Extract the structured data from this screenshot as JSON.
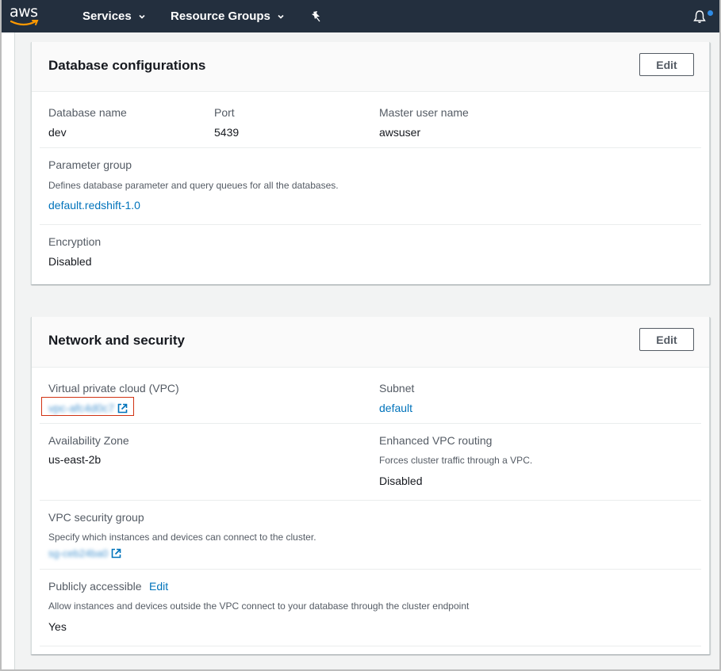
{
  "navbar": {
    "logo": "aws",
    "services_label": "Services",
    "resource_groups_label": "Resource Groups",
    "icons": [
      "aws-logo",
      "chevron-down-icon",
      "pin-icon",
      "bell-icon",
      "notification-dot"
    ]
  },
  "database_configurations": {
    "title": "Database configurations",
    "edit_label": "Edit",
    "database_name_label": "Database name",
    "database_name_value": "dev",
    "port_label": "Port",
    "port_value": "5439",
    "master_user_label": "Master user name",
    "master_user_value": "awsuser",
    "parameter_group_label": "Parameter group",
    "parameter_group_desc": "Defines database parameter and query queues for all the databases.",
    "parameter_group_value": "default.redshift-1.0",
    "encryption_label": "Encryption",
    "encryption_value": "Disabled"
  },
  "network_security": {
    "title": "Network and security",
    "edit_label": "Edit",
    "vpc_label": "Virtual private cloud (VPC)",
    "vpc_value": "vpc-afc4d0c7",
    "subnet_label": "Subnet",
    "subnet_value": "default",
    "az_label": "Availability Zone",
    "az_value": "us-east-2b",
    "enhanced_vpc_label": "Enhanced VPC routing",
    "enhanced_vpc_desc": "Forces cluster traffic through a VPC.",
    "enhanced_vpc_value": "Disabled",
    "sg_label": "VPC security group",
    "sg_desc": "Specify which instances and devices can connect to the cluster.",
    "sg_value": "sg-ceb24ba0",
    "public_label": "Publicly accessible",
    "public_edit_label": "Edit",
    "public_desc": "Allow instances and devices outside the VPC connect to your database through the cluster endpoint",
    "public_value": "Yes"
  },
  "colors": {
    "navbar": "#232f3e",
    "link": "#0073bb",
    "highlight_border": "#d13212",
    "notification": "#2e8be6",
    "page_bg": "#f2f3f3"
  }
}
